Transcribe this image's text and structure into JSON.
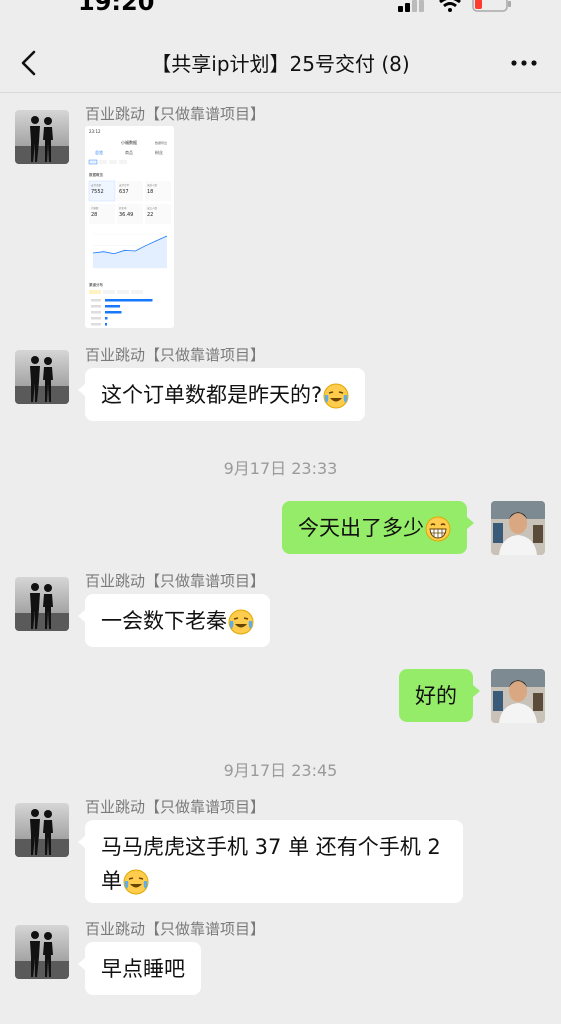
{
  "status_bar": {
    "time": "19:20"
  },
  "header": {
    "title": "【共享ip计划】25号交付 (8)"
  },
  "messages": [
    {
      "sender": "百业跳动【只做靠谱项目】",
      "text": ""
    },
    {
      "sender": "百业跳动【只做靠谱项目】",
      "text": "这个订单数都是昨天的?"
    },
    {
      "sender": "",
      "text": "今天出了多少"
    },
    {
      "sender": "百业跳动【只做靠谱项目】",
      "text": "一会数下老秦"
    },
    {
      "sender": "",
      "text": "好的"
    },
    {
      "sender": "百业跳动【只做靠谱项目】",
      "text": "马马虎虎这手机 37 单 还有个手机 2 单"
    },
    {
      "sender": "百业跳动【只做靠谱项目】",
      "text": "早点睡吧"
    }
  ],
  "timestamps": [
    "9月17日 23:33",
    "9月17日 23:45"
  ],
  "screenshot": {
    "time": "23:12",
    "title": "小福数据",
    "right_link": "数据导出",
    "tabs": [
      "总览",
      "商品",
      "粉丝"
    ],
    "stats": [
      {
        "label": "支付金额",
        "value": "7552"
      },
      {
        "label": "支付订单",
        "value": "637"
      },
      {
        "label": "退款人数",
        "value": "18"
      },
      {
        "label": "访客数",
        "value": "28"
      },
      {
        "label": "转化率",
        "value": "36.49"
      },
      {
        "label": "成交人数",
        "value": "22"
      }
    ],
    "section_overview": "数据概览",
    "section_dist": "渠道分布",
    "chart_values": [
      22,
      24,
      21,
      26,
      25,
      33,
      40,
      47
    ],
    "bars": [
      95,
      30,
      33,
      5,
      4
    ]
  }
}
